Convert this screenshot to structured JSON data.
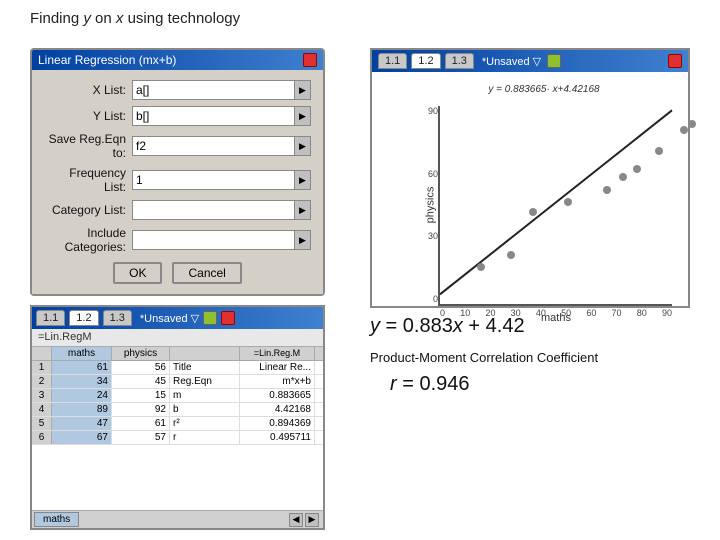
{
  "page": {
    "title": "Finding y on x using technology"
  },
  "dialog": {
    "title": "Linear Regression (mx+b)",
    "fields": [
      {
        "label": "X List:",
        "value": "a[]"
      },
      {
        "label": "Y List:",
        "value": "b[]"
      },
      {
        "label": "Save Reg.Eqn to:",
        "value": "f2"
      },
      {
        "label": "Frequency List:",
        "value": "1"
      },
      {
        "label": "Category List:",
        "value": ""
      },
      {
        "label": "Include Categories:",
        "value": ""
      }
    ],
    "ok_label": "OK",
    "cancel_label": "Cancel"
  },
  "graph": {
    "tabs": [
      "1.1",
      "1.2",
      "1.3"
    ],
    "active_tab": "*Unsaved",
    "equation": "y = 0.883665· x+4.42168",
    "x_label": "maths",
    "y_label": "physics",
    "x_ticks": [
      "0",
      "10",
      "20",
      "30",
      "40",
      "50",
      "60",
      "70",
      "80",
      "90"
    ],
    "y_ticks": [
      "0",
      "30",
      "60",
      "90"
    ],
    "points": [
      {
        "x": 15,
        "y": 18
      },
      {
        "x": 26,
        "y": 24
      },
      {
        "x": 34,
        "y": 45
      },
      {
        "x": 47,
        "y": 50
      },
      {
        "x": 61,
        "y": 56
      },
      {
        "x": 67,
        "y": 62
      },
      {
        "x": 72,
        "y": 66
      },
      {
        "x": 80,
        "y": 75
      },
      {
        "x": 89,
        "y": 85
      },
      {
        "x": 92,
        "y": 88
      }
    ]
  },
  "spreadsheet": {
    "formula_bar": "=Lin.RegM",
    "col_headers": [
      "maths",
      "physics",
      "Title",
      "Linear Re..."
    ],
    "rows": [
      {
        "num": "1",
        "maths": "61",
        "physics": "56",
        "title": "Title",
        "linreg": "Linear Re..."
      },
      {
        "num": "2",
        "maths": "34",
        "physics": "45",
        "title": "Reg.Eqn",
        "linreg": "m*x+b"
      },
      {
        "num": "3",
        "maths": "24",
        "physics": "15",
        "title": "m",
        "linreg": "0.883665"
      },
      {
        "num": "4",
        "maths": "89",
        "physics": "92",
        "title": "b",
        "linreg": "4.42168"
      },
      {
        "num": "5",
        "maths": "47",
        "physics": "61",
        "title": "r²",
        "linreg": "0.894369"
      },
      {
        "num": "6",
        "maths": "67",
        "physics": "57",
        "title": "r",
        "linreg": "0.495711"
      }
    ],
    "footer_tab": "maths"
  },
  "formula": {
    "eq_label": "y = 0.883 x + 4.42",
    "pmc_label": "Product-Moment Correlation Coefficient",
    "r_label": "r = 0.946"
  }
}
